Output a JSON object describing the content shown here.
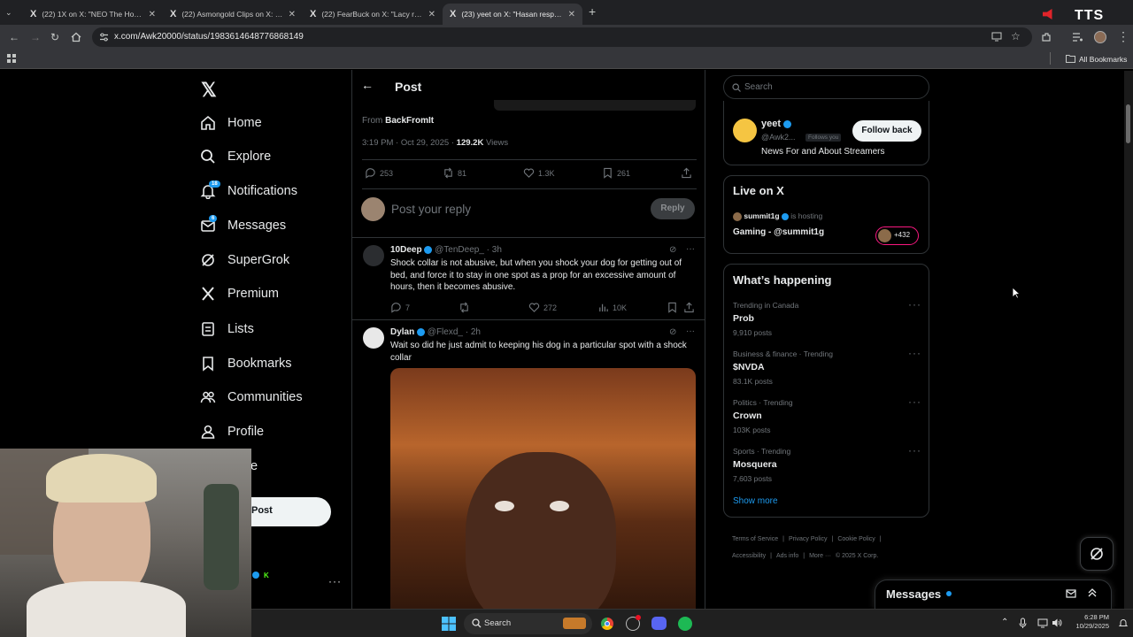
{
  "browser": {
    "tabs": [
      {
        "title": "(22) 1X on X: \"NEO The Home R",
        "active": false
      },
      {
        "title": "(22) Asmongold Clips on X: \"\"B",
        "active": false
      },
      {
        "title": "(22) FearBuck on X: \"Lacy respo",
        "active": false
      },
      {
        "title": "(23) yeet on X: \"Hasan respond",
        "active": true
      }
    ],
    "new_tab": "+",
    "url": "x.com/Awk20000/status/1983614648776868149",
    "all_bookmarks": "All Bookmarks",
    "overlay_text": "TTS"
  },
  "nav": {
    "items": [
      {
        "label": "Home",
        "icon": "home-icon"
      },
      {
        "label": "Explore",
        "icon": "search-icon"
      },
      {
        "label": "Notifications",
        "icon": "bell-icon",
        "badge": "18"
      },
      {
        "label": "Messages",
        "icon": "mail-icon",
        "badge": "6"
      },
      {
        "label": "SuperGrok",
        "icon": "grok-icon"
      },
      {
        "label": "Premium",
        "icon": "x-logo-icon"
      },
      {
        "label": "Lists",
        "icon": "list-icon"
      },
      {
        "label": "Bookmarks",
        "icon": "bookmark-icon"
      },
      {
        "label": "Communities",
        "icon": "people-icon"
      },
      {
        "label": "Profile",
        "icon": "person-icon"
      }
    ],
    "more_partial": "e",
    "post_button": "Post"
  },
  "post": {
    "header": "Post",
    "from_label": "From",
    "from_name": "BackFromIt",
    "time": "3:19 PM · Oct 29, 2025 · ",
    "views_count": "129.2K",
    "views_label": " Views",
    "stats": {
      "replies": "253",
      "reposts": "81",
      "likes": "1.3K",
      "bookmarks": "261"
    },
    "reply_placeholder": "Post your reply",
    "reply_button": "Reply"
  },
  "replies": [
    {
      "name": "10Deep",
      "handle": "@TenDeep_ · 3h",
      "text": "Shock collar is not abusive, but when you shock your dog for getting out of bed, and force it to stay in one spot as a prop for an excessive amount of hours, then it becomes abusive.",
      "stats": {
        "replies": "7",
        "reposts": "",
        "likes": "272",
        "views": "10K"
      }
    },
    {
      "name": "Dylan",
      "handle": "@Flexd_ · 2h",
      "text": "Wait so did he just admit to keeping his dog in a particular spot with a shock collar"
    }
  ],
  "right": {
    "search_placeholder": "Search",
    "follow_card": {
      "name": "yeet",
      "handle": "@Awk2...",
      "follows_you": "Follows you",
      "button": "Follow back",
      "bio": "News For and About Streamers"
    },
    "live": {
      "title": "Live on X",
      "host": "summit1g",
      "hosting": "is hosting",
      "stream_title": "Gaming - @summit1g",
      "count": "+432"
    },
    "happening": {
      "title": "What’s happening",
      "trends": [
        {
          "category": "Trending in Canada",
          "name": "Prob",
          "posts": "9,910 posts"
        },
        {
          "category": "Business & finance · Trending",
          "name": "$NVDA",
          "posts": "83.1K posts"
        },
        {
          "category": "Politics · Trending",
          "name": "Crown",
          "posts": "103K posts"
        },
        {
          "category": "Sports · Trending",
          "name": "Mosquera",
          "posts": "7,603 posts"
        }
      ],
      "show_more": "Show more"
    },
    "footer": {
      "links": [
        "Terms of Service",
        "Privacy Policy",
        "Cookie Policy",
        "Accessibility",
        "Ads info",
        "More ···"
      ],
      "copyright": "© 2025 X Corp."
    },
    "messages_drawer": "Messages"
  },
  "taskbar": {
    "search": "Search",
    "time": "6:28 PM",
    "date": "10/29/2025"
  },
  "colors": {
    "accent": "#1d9bf0",
    "background": "#000000",
    "border": "#2f3336",
    "muted": "#71767b"
  }
}
